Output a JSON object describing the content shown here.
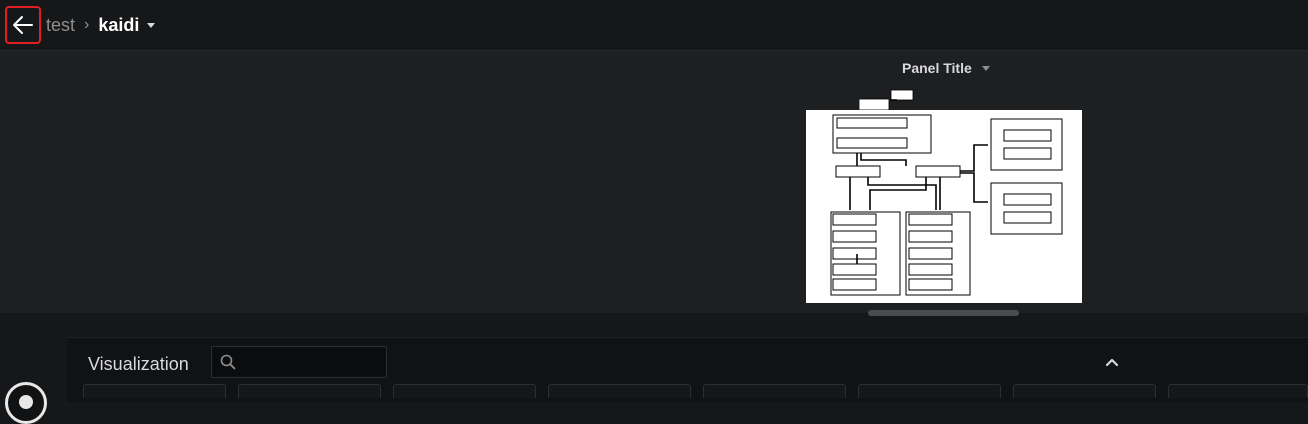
{
  "breadcrumb": {
    "parent": "test",
    "separator": "›",
    "current": "kaidi"
  },
  "panel": {
    "title": "Panel Title"
  },
  "visualization": {
    "label": "Visualization",
    "search_placeholder": ""
  },
  "icons": {
    "back": "arrow-left-icon",
    "caret": "caret-down-icon",
    "search": "search-icon",
    "collapse": "chevron-up-icon"
  },
  "colors": {
    "highlight": "#e02020",
    "background": "#161719",
    "panel_bg": "#1e1f21"
  }
}
